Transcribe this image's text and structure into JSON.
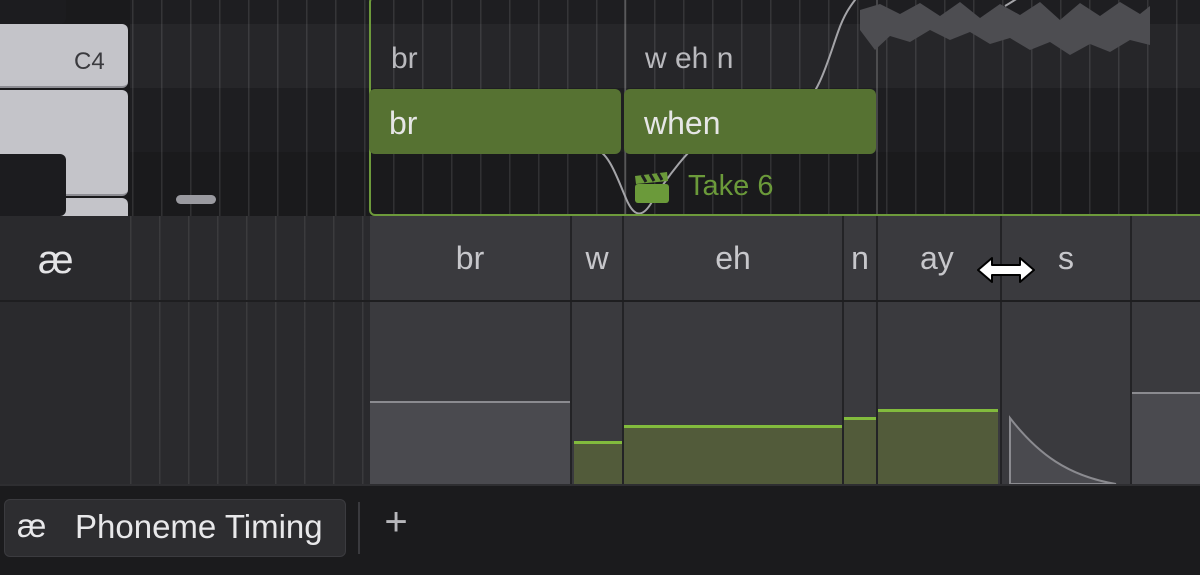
{
  "piano_roll": {
    "key_label": "C4",
    "phoneme_line": [
      "br",
      "w eh n"
    ],
    "notes": [
      {
        "lyric": "br"
      },
      {
        "lyric": "when"
      }
    ],
    "take_label": "Take 6"
  },
  "lower_panel": {
    "lane_icon": "æ",
    "phonemes": [
      "br",
      "w",
      "eh",
      "n",
      "ay",
      "s"
    ],
    "phoneme_levels": [
      0.31,
      0.16,
      0.22,
      0.25,
      0.28,
      0.0
    ],
    "cursor_icon": "horizontal-resize-cursor-icon"
  },
  "tab_bar": {
    "tabs": [
      {
        "icon": "æ",
        "label": "Phoneme Timing"
      }
    ],
    "add_icon": "+"
  },
  "colors": {
    "accent_green": "#82bb3d",
    "note_fill": "#567232",
    "region_border": "#6d9a3b"
  }
}
